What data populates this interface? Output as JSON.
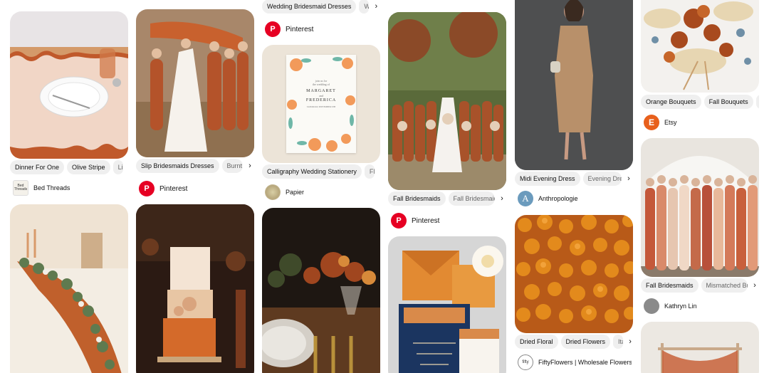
{
  "columns": [
    {
      "pins": [
        {
          "chips": [
            "Dinner For One",
            "Olive Stripe",
            "Linen"
          ],
          "source": "Bed Threads",
          "source_avatar_text": "Bed Threads"
        },
        {
          "chips": [],
          "source": ""
        }
      ]
    },
    {
      "pins": [
        {
          "chips": [
            "Slip Bridesmaids Dresses",
            "Burnt Orange"
          ],
          "source": "Pinterest"
        },
        {
          "chips": [],
          "source": ""
        }
      ]
    },
    {
      "pins": [
        {
          "chips": [
            "Wedding Bridesmaid Dresses",
            "Wedding"
          ],
          "source": "Pinterest"
        },
        {
          "chips": [
            "Calligraphy Wedding Stationery",
            "Flo"
          ],
          "source": "Papier",
          "invite": {
            "line1": "join us for",
            "line2": "the wedding of",
            "name1": "MARGARET",
            "and": "and",
            "name2": "FREDERICA",
            "details": "SATURDAY, SEPTEMBER 9TH"
          }
        },
        {
          "chips": [],
          "source": ""
        }
      ]
    },
    {
      "pins": [
        {
          "chips": [
            "Fall Bridesmaids",
            "Fall Bridesmaid Dresses"
          ],
          "source": "Pinterest"
        },
        {
          "chips": [],
          "source": ""
        }
      ]
    },
    {
      "pins": [
        {
          "chips": [
            "Midi Evening Dress",
            "Evening Dresses"
          ],
          "source": "Anthropologie",
          "source_avatar_text": "A"
        },
        {
          "chips": [
            "Dried Floral",
            "Dried Flowers",
            "Italian"
          ],
          "source": "FiftyFlowers | Wholesale Flowers ...",
          "source_avatar_text": "fifty"
        }
      ]
    },
    {
      "pins": [
        {
          "chips": [
            "Orange Bouquets",
            "Fall Bouquets",
            "B"
          ],
          "source": "Etsy",
          "source_avatar_text": "E"
        },
        {
          "chips": [
            "Fall Bridesmaids",
            "Mismatched Brides"
          ],
          "source": "Kathryn Lin"
        },
        {
          "chips": [],
          "source": ""
        }
      ]
    }
  ],
  "icons": {
    "chevron": "chevron-right-icon",
    "pinterest": "pinterest-logo-icon"
  },
  "colors": {
    "chip_bg": "#efefef",
    "pinterest_red": "#e60023",
    "etsy_orange": "#e8601c",
    "page_bg": "#ffffff"
  }
}
